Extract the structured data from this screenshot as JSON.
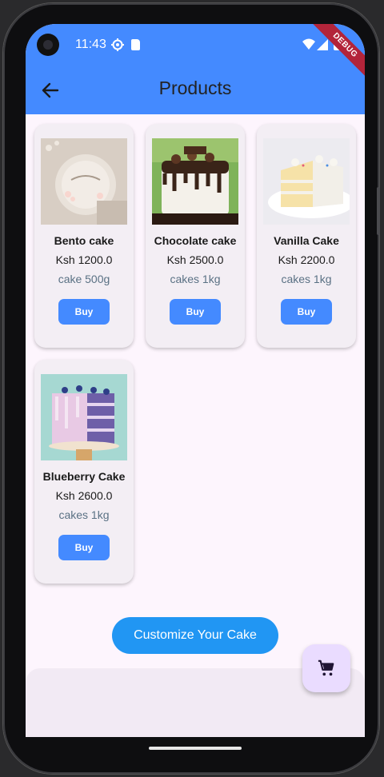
{
  "status": {
    "time": "11:43",
    "debug": "DEBUG",
    "icons": [
      "gear-icon",
      "sd-card-icon",
      "wifi-icon",
      "signal-icon",
      "battery-icon"
    ]
  },
  "appbar": {
    "title": "Products",
    "back_icon": "arrow-back-icon"
  },
  "products": [
    {
      "name": "Bento cake",
      "price": "Ksh 1200.0",
      "category": "cake 500g",
      "buy": "Buy"
    },
    {
      "name": "Chocolate cake",
      "price": "Ksh 2500.0",
      "category": "cakes 1kg",
      "buy": "Buy"
    },
    {
      "name": "Vanilla Cake",
      "price": "Ksh 2200.0",
      "category": "cakes 1kg",
      "buy": "Buy"
    },
    {
      "name": "Blueberry Cake",
      "price": "Ksh 2600.0",
      "category": "cakes 1kg",
      "buy": "Buy"
    }
  ],
  "customize": {
    "label": "Customize Your Cake"
  },
  "fab": {
    "icon": "shopping-cart-icon"
  },
  "colors": {
    "appbar": "#448aff",
    "button": "#448aff",
    "customize": "#2196f3",
    "fab": "#eadcff",
    "background": "#fdf5fd"
  }
}
